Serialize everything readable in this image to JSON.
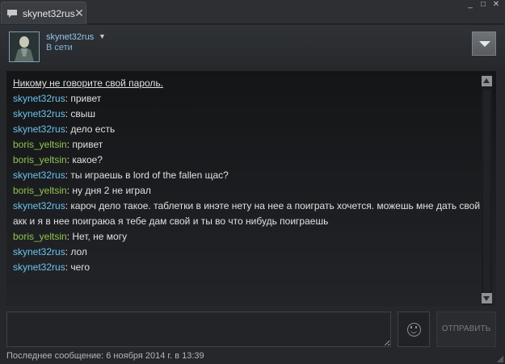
{
  "titlebar": {
    "tab_title": "skynet32rus",
    "tab_close": "✕",
    "controls": [
      "_",
      "□",
      "✕"
    ]
  },
  "header": {
    "username": "skynet32rus",
    "status": "В сети",
    "dropdown_glyph": "▼"
  },
  "chat": {
    "warning": "Никому не говорите свой пароль.",
    "messages": [
      {
        "name": "skynet32rus",
        "color": "#6cc3ea",
        "text": "привет"
      },
      {
        "name": "skynet32rus",
        "color": "#6cc3ea",
        "text": "свыш"
      },
      {
        "name": "skynet32rus",
        "color": "#6cc3ea",
        "text": "дело есть"
      },
      {
        "name": "boris_yeltsin",
        "color": "#90c34b",
        "text": "привет"
      },
      {
        "name": "boris_yeltsin",
        "color": "#90c34b",
        "text": "какое?"
      },
      {
        "name": "skynet32rus",
        "color": "#6cc3ea",
        "text": "ты играешь в lord of the fallen щас?"
      },
      {
        "name": "boris_yeltsin",
        "color": "#90c34b",
        "text": "ну дня 2 не играл"
      },
      {
        "name": "skynet32rus",
        "color": "#6cc3ea",
        "text": "кароч дело такое. таблетки в инэте нету на нее а поиграть хочется. можешь мне дать свой акк и я в нее поиграюа я тебе дам свой и ты во что нибудь поиграешь"
      },
      {
        "name": "boris_yeltsin",
        "color": "#90c34b",
        "text": "Нет, не могу"
      },
      {
        "name": "skynet32rus",
        "color": "#6cc3ea",
        "text": "лол"
      },
      {
        "name": "skynet32rus",
        "color": "#6cc3ea",
        "text": "чего"
      }
    ]
  },
  "compose": {
    "input_value": "",
    "send_label": "ОТПРАВИТЬ"
  },
  "footer": {
    "last_message": "Последнее сообщение: 6 ноября 2014 г. в 13:39"
  },
  "colors": {
    "friend_name": "#6cc3ea",
    "self_name": "#90c34b",
    "background": "#25272b"
  }
}
